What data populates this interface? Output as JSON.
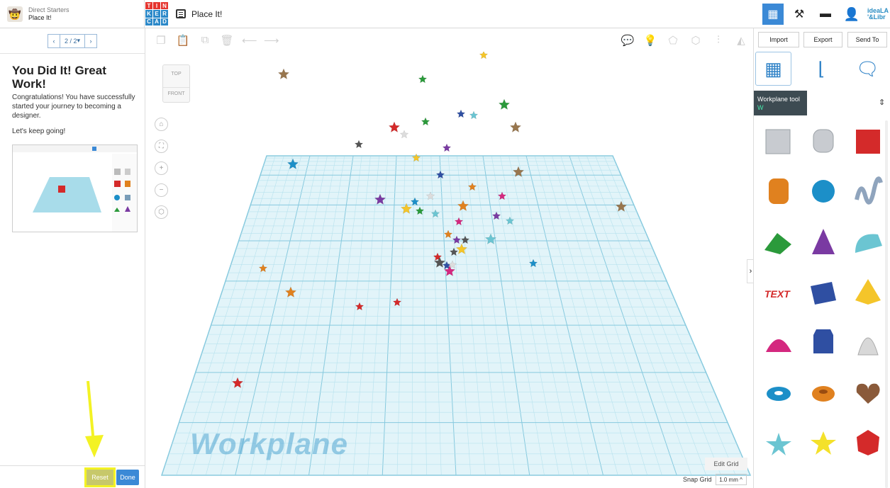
{
  "header": {
    "lesson_subtitle": "Direct Starters",
    "lesson_title": "Place It!",
    "doc_title": "Place It!",
    "logo_letters": [
      "T",
      "I",
      "N",
      "K",
      "E",
      "R",
      "C",
      "A",
      "D"
    ],
    "logo_colors": [
      "#e5352f",
      "#e5352f",
      "#e5352f",
      "#2c89c9",
      "#2c89c9",
      "#2c89c9",
      "#2c89c9",
      "#2c89c9",
      "#2c89c9"
    ],
    "brand_line1": "ideaLA",
    "brand_line2": "'&Libr"
  },
  "lesson": {
    "pager": "2 / 2",
    "title": "You Did It! Great Work!",
    "paragraph1": "Congratulations! You have successfully started your journey to becoming a designer.",
    "paragraph2": "Let's keep going!",
    "reset_label": "Reset",
    "done_label": "Done"
  },
  "toolbar": {
    "left_icons": [
      "copy-icon",
      "paste-icon",
      "duplicate-icon",
      "delete-icon",
      "undo-icon",
      "redo-icon"
    ],
    "right_icons": [
      "notes-icon",
      "light-icon",
      "shape-icon",
      "shape-outline-icon",
      "align-icon",
      "mirror-icon"
    ]
  },
  "canvas": {
    "view_cube_top": "TOP",
    "view_cube_front": "FRONT",
    "workplane_label": "Workplane",
    "edit_grid_label": "Edit Grid",
    "snap_grid_label": "Snap Grid",
    "snap_grid_value": "1.0 mm ^"
  },
  "right_panel": {
    "import_label": "Import",
    "export_label": "Export",
    "send_to_label": "Send To",
    "tooltip_title": "Workplane tool",
    "tooltip_key": "W"
  },
  "colors": {
    "accent": "#3b89d6",
    "grid": "#a7ddeb",
    "highlight": "#f3f224"
  }
}
